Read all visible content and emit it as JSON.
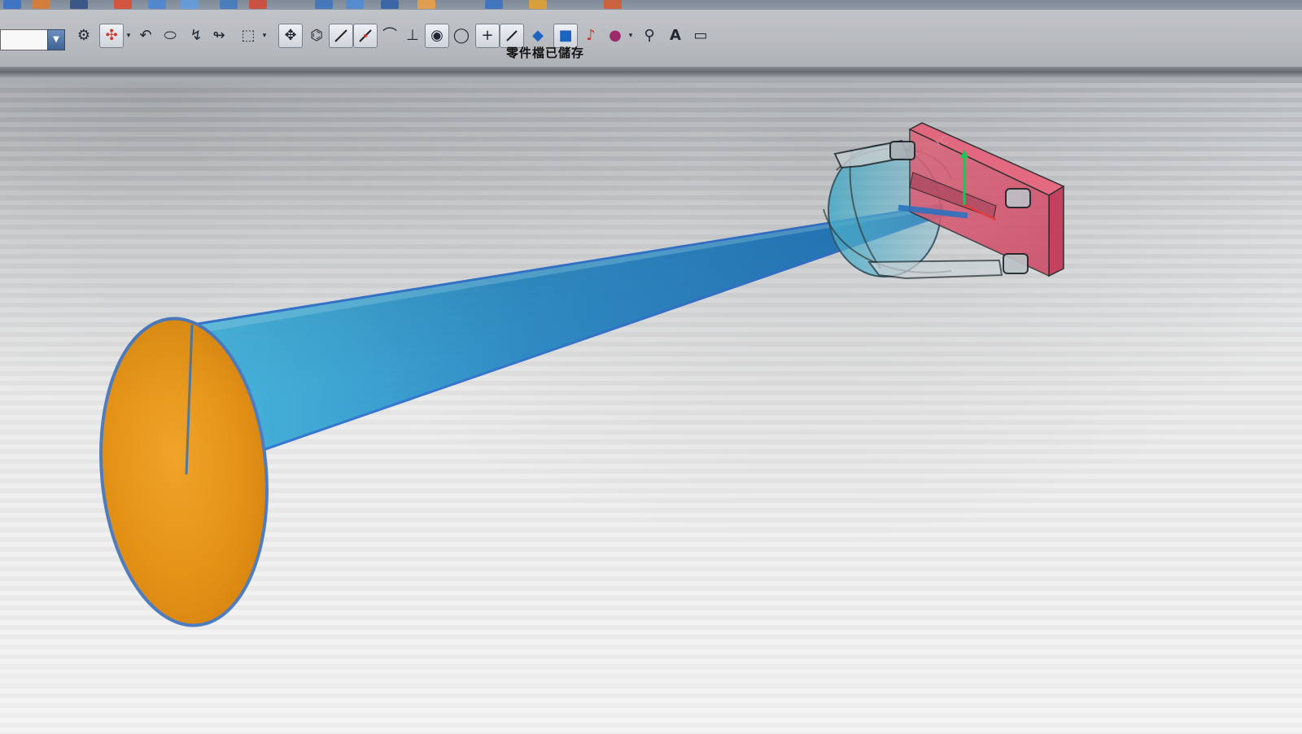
{
  "app": {
    "status_message": "零件檔已儲存",
    "part_name_value": "",
    "view_axis_label": "YC"
  },
  "toolbar": {
    "tools": [
      {
        "name": "select-filter-icon"
      },
      {
        "name": "component-icon"
      },
      {
        "name": "undo-icon"
      },
      {
        "name": "solid-body-icon"
      },
      {
        "name": "curve-icon"
      },
      {
        "name": "hook-icon"
      },
      {
        "name": "rectangle-select-icon"
      },
      {
        "name": "snap-points-icon"
      },
      {
        "name": "feature-icon"
      },
      {
        "name": "line-icon"
      },
      {
        "name": "slash-line-icon"
      },
      {
        "name": "arc-tangent-icon"
      },
      {
        "name": "split-icon"
      },
      {
        "name": "center-point-icon"
      },
      {
        "name": "circle-icon"
      },
      {
        "name": "plus-point-icon"
      },
      {
        "name": "edge-line-icon"
      },
      {
        "name": "rotate-view-icon"
      },
      {
        "name": "shaded-cube-icon"
      },
      {
        "name": "sketch-icon"
      },
      {
        "name": "render-sphere-icon"
      },
      {
        "name": "measure-icon"
      },
      {
        "name": "text-icon"
      },
      {
        "name": "frame-icon"
      }
    ],
    "text_tool_label": "A"
  },
  "colors": {
    "cone": "#3c9bd6",
    "disc": "#e59018",
    "part": "#e85f78",
    "axis_green": "#17d85f",
    "axis_red": "#f04242",
    "toolbar": "#b9bcc0"
  }
}
